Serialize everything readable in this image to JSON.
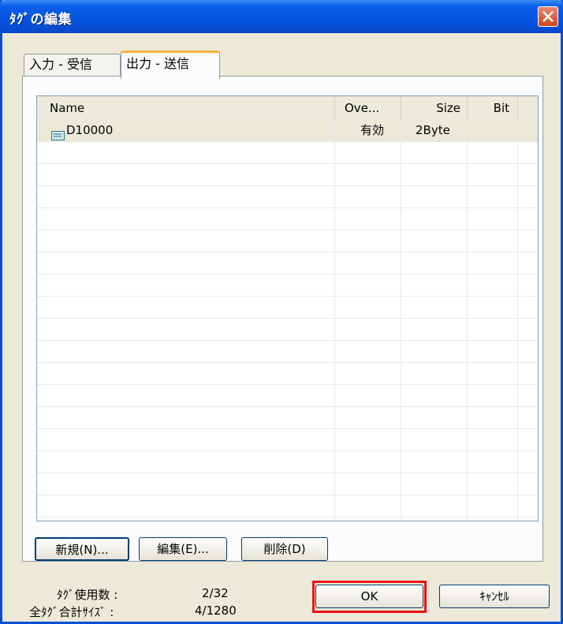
{
  "window": {
    "title": "ﾀｸﾞの編集"
  },
  "tabs": [
    {
      "label": "入力 - 受信",
      "active": false
    },
    {
      "label": "出力 - 送信",
      "active": true
    }
  ],
  "list": {
    "columns": [
      "Name",
      "Ove...",
      "Size",
      "Bit"
    ],
    "rows": [
      {
        "icon": "tag-icon",
        "name": "D10000",
        "override": "有効",
        "size": "2Byte",
        "bit": ""
      }
    ]
  },
  "buttons": {
    "new": "新規(N)...",
    "edit": "編集(E)...",
    "delete": "削除(D)",
    "ok": "OK",
    "cancel": "ｷｬﾝｾﾙ"
  },
  "status": {
    "tag_count_label": "ﾀｸﾞ使用数 :",
    "tag_count_value": "2/32",
    "total_size_label": "全ﾀｸﾞ合計ｻｲｽﾞ :",
    "total_size_value": "4/1280"
  },
  "colors": {
    "titlebar": "#0554e0",
    "highlight": "#ee1111",
    "tab_accent": "#f8b03a"
  }
}
